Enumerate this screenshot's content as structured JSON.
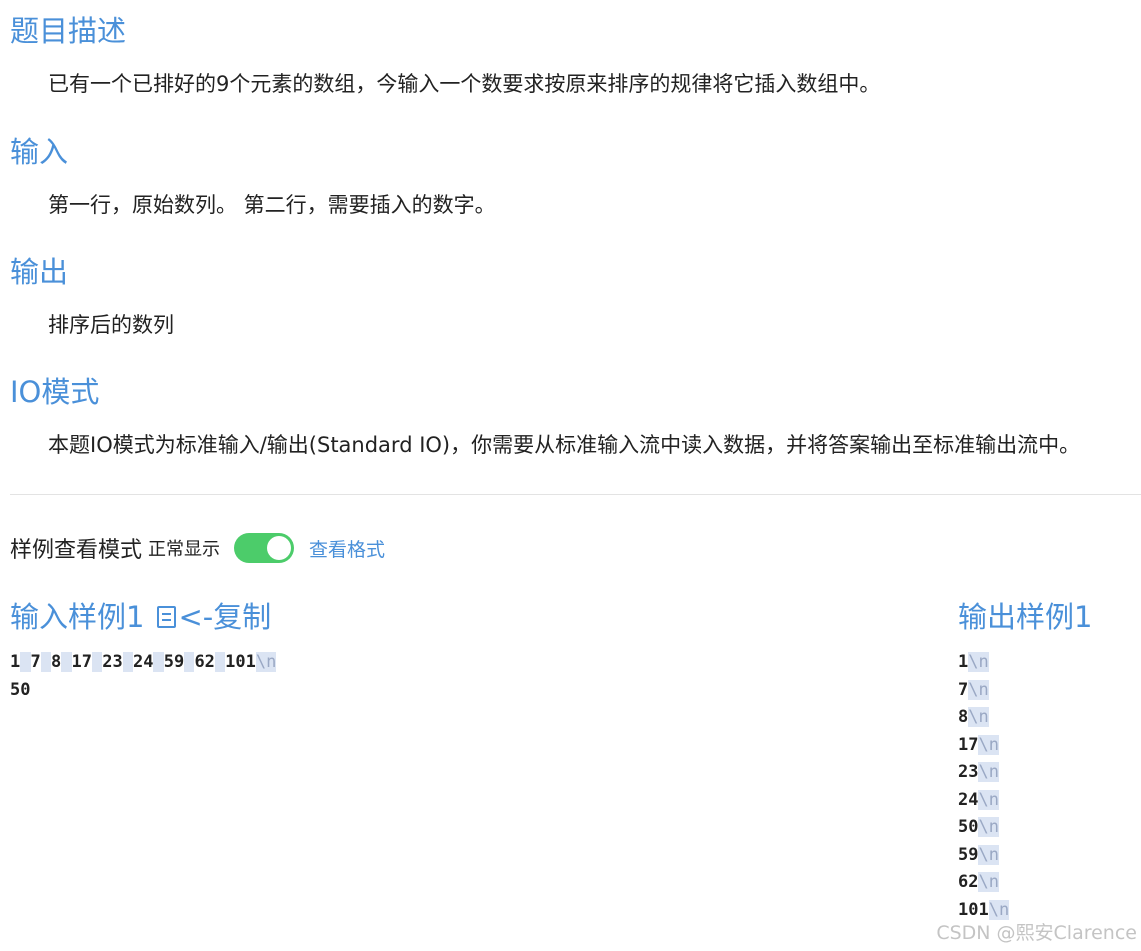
{
  "description": {
    "title": "题目描述",
    "body": "已有一个已排好的9个元素的数组，今输入一个数要求按原来排序的规律将它插入数组中。"
  },
  "input": {
    "title": "输入",
    "body": "第一行，原始数列。 第二行，需要插入的数字。"
  },
  "output": {
    "title": "输出",
    "body": "排序后的数列"
  },
  "io_mode": {
    "title": "IO模式",
    "body": "本题IO模式为标准输入/输出(Standard IO)，你需要从标准输入流中读入数据，并将答案输出至标准输出流中。"
  },
  "sample_mode": {
    "label": "样例查看模式",
    "value": "正常显示",
    "toggle_on": true,
    "toggle_color": "#4ccc6a",
    "view_format_link": "查看格式"
  },
  "input_sample": {
    "title": "输入样例1",
    "copy_label": "<-复制",
    "lines": [
      {
        "tokens": [
          "1",
          "7",
          "8",
          "17",
          "23",
          "24",
          "59",
          "62",
          "101"
        ],
        "newline": true
      },
      {
        "tokens": [
          "50"
        ],
        "newline": false
      }
    ]
  },
  "output_sample": {
    "title": "输出样例1",
    "lines": [
      {
        "tokens": [
          "1"
        ],
        "newline": true
      },
      {
        "tokens": [
          "7"
        ],
        "newline": true
      },
      {
        "tokens": [
          "8"
        ],
        "newline": true
      },
      {
        "tokens": [
          "17"
        ],
        "newline": true
      },
      {
        "tokens": [
          "23"
        ],
        "newline": true
      },
      {
        "tokens": [
          "24"
        ],
        "newline": true
      },
      {
        "tokens": [
          "50"
        ],
        "newline": true
      },
      {
        "tokens": [
          "59"
        ],
        "newline": true
      },
      {
        "tokens": [
          "62"
        ],
        "newline": true
      },
      {
        "tokens": [
          "101"
        ],
        "newline": true
      }
    ]
  },
  "newline_marker": "\\n",
  "watermark": "CSDN @熙安Clarence",
  "colors": {
    "accent": "#4a90d9",
    "whitespace_highlight": "#dbe4f3",
    "newline_text": "#9aa8c4"
  }
}
